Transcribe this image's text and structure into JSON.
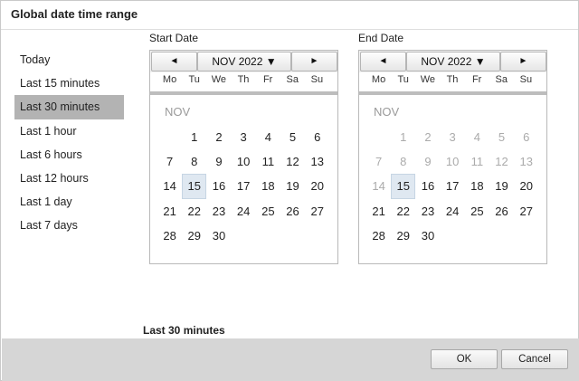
{
  "dialog": {
    "title": "Global date time range"
  },
  "presets": [
    {
      "label": "Today"
    },
    {
      "label": "Last 15 minutes"
    },
    {
      "label": "Last 30 minutes",
      "selected": true
    },
    {
      "label": "Last 1 hour"
    },
    {
      "label": "Last 6 hours"
    },
    {
      "label": "Last 12 hours"
    },
    {
      "label": "Last 1 day"
    },
    {
      "label": "Last 7 days"
    }
  ],
  "start_calendar": {
    "label": "Start Date",
    "prev_glyph": "◄",
    "month_label": "NOV 2022 ▼",
    "next_glyph": "►",
    "month_name": "NOV",
    "weekdays": [
      "Mo",
      "Tu",
      "We",
      "Th",
      "Fr",
      "Sa",
      "Su"
    ],
    "weeks": [
      [
        "",
        "1",
        "2",
        "3",
        "4",
        "5",
        "6"
      ],
      [
        "7",
        "8",
        "9",
        "10",
        "11",
        "12",
        "13"
      ],
      [
        "14",
        "15",
        "16",
        "17",
        "18",
        "19",
        "20"
      ],
      [
        "21",
        "22",
        "23",
        "24",
        "25",
        "26",
        "27"
      ],
      [
        "28",
        "29",
        "30",
        "",
        "",
        "",
        ""
      ]
    ],
    "today": "15",
    "disabled_before": "0"
  },
  "end_calendar": {
    "label": "End Date",
    "prev_glyph": "◄",
    "month_label": "NOV 2022 ▼",
    "next_glyph": "►",
    "month_name": "NOV",
    "weekdays": [
      "Mo",
      "Tu",
      "We",
      "Th",
      "Fr",
      "Sa",
      "Su"
    ],
    "weeks": [
      [
        "",
        "1",
        "2",
        "3",
        "4",
        "5",
        "6"
      ],
      [
        "7",
        "8",
        "9",
        "10",
        "11",
        "12",
        "13"
      ],
      [
        "14",
        "15",
        "16",
        "17",
        "18",
        "19",
        "20"
      ],
      [
        "21",
        "22",
        "23",
        "24",
        "25",
        "26",
        "27"
      ],
      [
        "28",
        "29",
        "30",
        "",
        "",
        "",
        ""
      ]
    ],
    "today": "15",
    "disabled_before": "15"
  },
  "summary": {
    "text": "Last 30 minutes"
  },
  "footer": {
    "ok_label": "OK",
    "cancel_label": "Cancel"
  }
}
